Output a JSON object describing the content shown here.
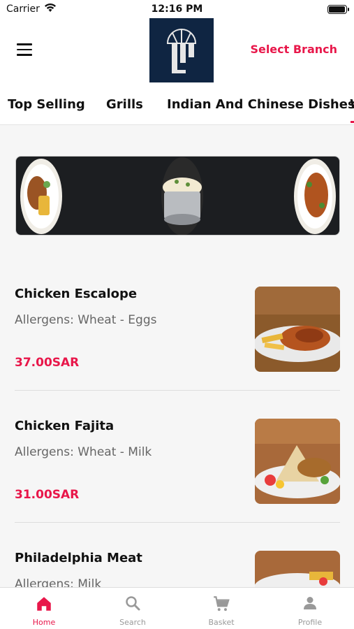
{
  "status_bar": {
    "carrier": "Carrier",
    "time": "12:16 PM"
  },
  "header": {
    "select_branch": "Select Branch"
  },
  "category_tabs": [
    {
      "label": "Top Selling"
    },
    {
      "label": "Grills"
    },
    {
      "label": "Indian And Chinese Dishes"
    },
    {
      "label": "W"
    }
  ],
  "menu_items": [
    {
      "name": "Chicken Escalope",
      "allergens": "Allergens: Wheat - Eggs",
      "price": "37.00SAR"
    },
    {
      "name": "Chicken Fajita",
      "allergens": "Allergens: Wheat - Milk",
      "price": "31.00SAR"
    },
    {
      "name": "Philadelphia Meat",
      "allergens": "Allergens: Milk",
      "price": ""
    }
  ],
  "bottom_nav": [
    {
      "label": "Home",
      "icon": "home-icon",
      "active": true
    },
    {
      "label": "Search",
      "icon": "search-icon",
      "active": false
    },
    {
      "label": "Basket",
      "icon": "cart-icon",
      "active": false
    },
    {
      "label": "Profile",
      "icon": "profile-icon",
      "active": false
    }
  ],
  "colors": {
    "accent": "#e8174a",
    "logo_bg": "#0f2542",
    "banner_bg": "#1c1e21"
  }
}
